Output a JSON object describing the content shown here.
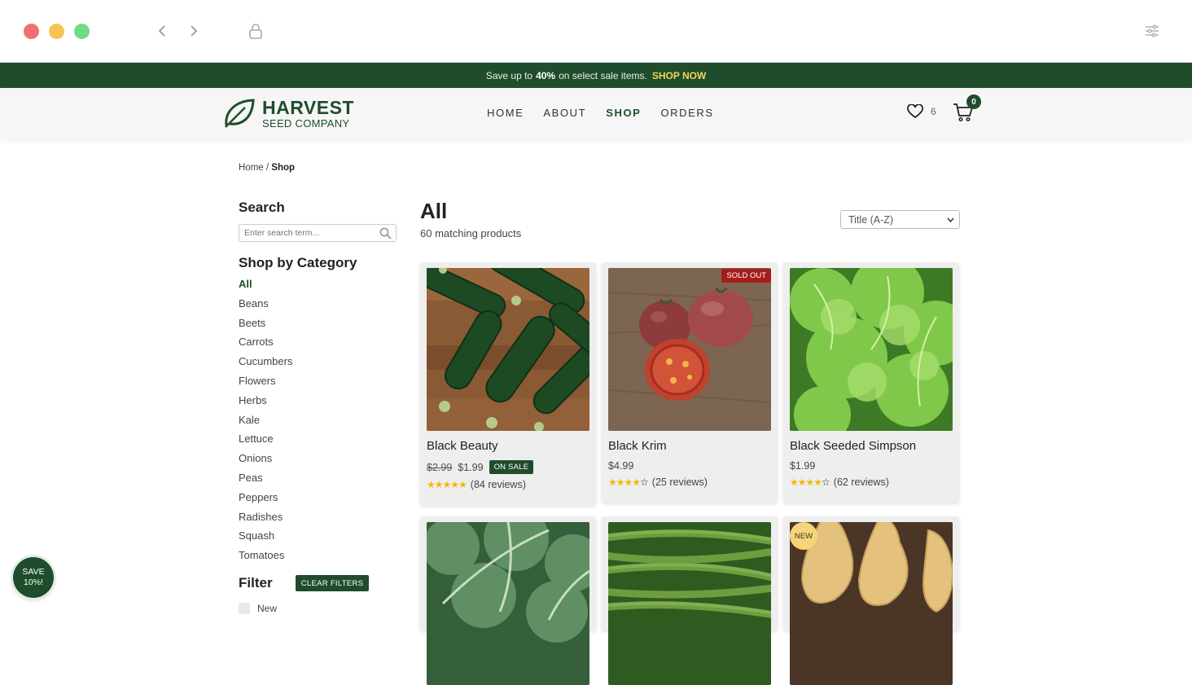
{
  "colors": {
    "brand": "#1f4d2b",
    "accent": "#f4d35e",
    "sold_out": "#a51c1c"
  },
  "promo": {
    "prefix": "Save up to",
    "bold": "40%",
    "suffix": "on select sale items.",
    "cta": "SHOP NOW"
  },
  "logo": {
    "line1": "HARVEST",
    "line2": "SEED COMPANY"
  },
  "nav": {
    "items": [
      "HOME",
      "ABOUT",
      "SHOP",
      "ORDERS"
    ],
    "active": "SHOP"
  },
  "wishlist": {
    "count": "6"
  },
  "cart": {
    "count": "0"
  },
  "breadcrumb": {
    "home": "Home",
    "sep": "/",
    "current": "Shop"
  },
  "sidebar": {
    "search_title": "Search",
    "search_placeholder": "Enter search term...",
    "category_title": "Shop by Category",
    "categories": [
      "All",
      "Beans",
      "Beets",
      "Carrots",
      "Cucumbers",
      "Flowers",
      "Herbs",
      "Kale",
      "Lettuce",
      "Onions",
      "Peas",
      "Peppers",
      "Radishes",
      "Squash",
      "Tomatoes"
    ],
    "selected_category": "All",
    "filter_title": "Filter",
    "clear_filters": "CLEAR FILTERS",
    "filters": [
      "New"
    ]
  },
  "save_badge": {
    "line1": "SAVE",
    "line2": "10%!"
  },
  "main": {
    "title": "All",
    "count": "60 matching products",
    "sort": {
      "selected": "Title (A-Z)"
    }
  },
  "products": [
    {
      "name": "Black Beauty",
      "old_price": "$2.99",
      "price": "$1.99",
      "badge": "ON SALE",
      "stars": 5,
      "reviews": "(84 reviews)",
      "image": "zucchini"
    },
    {
      "name": "Black Krim",
      "price": "$4.99",
      "label": "SOLD OUT",
      "stars": 4,
      "reviews": "(25 reviews)",
      "image": "tomato"
    },
    {
      "name": "Black Seeded Simpson",
      "price": "$1.99",
      "stars": 4,
      "reviews": "(62 reviews)",
      "image": "lettuce"
    },
    {
      "name": "",
      "image": "kale"
    },
    {
      "name": "",
      "image": "green-beans"
    },
    {
      "name": "",
      "label": "NEW",
      "image": "butternut-squash"
    }
  ],
  "icons": {
    "back": "chevron-left-icon",
    "forward": "chevron-right-icon",
    "lock": "lock-icon",
    "settings": "sliders-icon",
    "heart": "heart-icon",
    "cart": "cart-icon",
    "search": "search-icon"
  }
}
